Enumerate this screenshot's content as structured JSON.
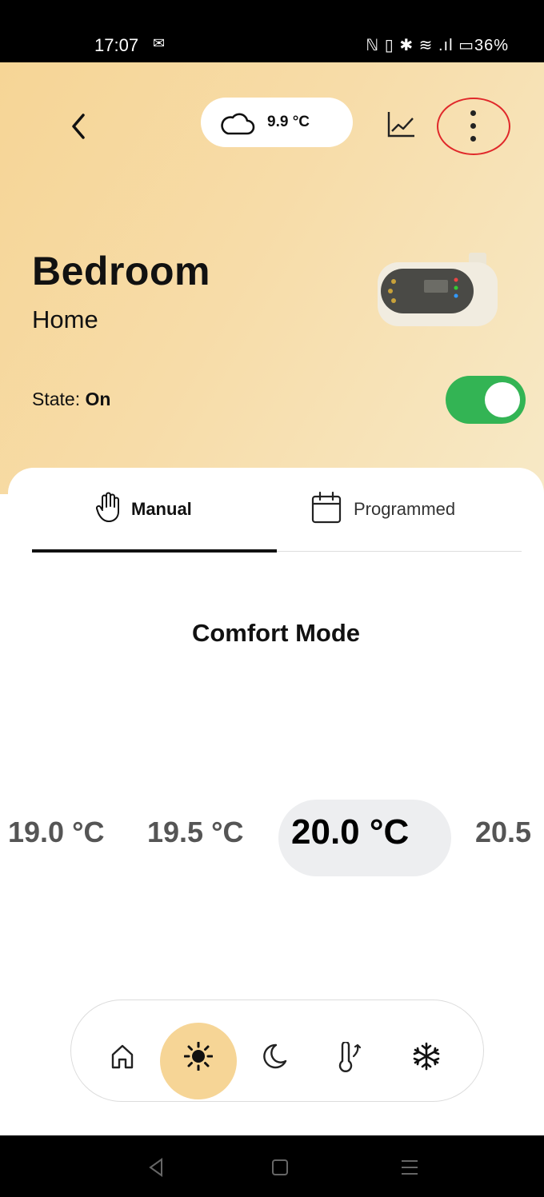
{
  "status_bar": {
    "time": "17:07",
    "mail_glyph": "✉",
    "right_icons": "ℕ ▯ ✱ ≋ .ıl ▭36%"
  },
  "header": {
    "weather_temp": "9.9 °C"
  },
  "room": {
    "name": "Bedroom",
    "location": "Home"
  },
  "state": {
    "label": "State: ",
    "value": "On",
    "toggle_on": true
  },
  "tabs": [
    {
      "label": "Manual",
      "active": true
    },
    {
      "label": "Programmed",
      "active": false
    }
  ],
  "mode": {
    "title": "Comfort Mode"
  },
  "temperatures": {
    "items": [
      "19.0 °C",
      "19.5 °C",
      "20.5"
    ],
    "selected": "20.0 °C"
  },
  "mode_buttons": [
    "home-icon",
    "sun-icon",
    "moon-icon",
    "thermometer-icon",
    "snowflake-icon"
  ],
  "colors": {
    "accent": "#f6d596",
    "toggle": "#33b454",
    "highlight_circle": "#e0282a"
  }
}
